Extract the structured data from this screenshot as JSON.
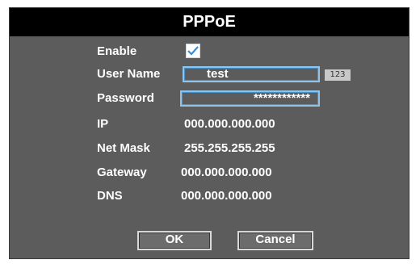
{
  "dialog": {
    "title": "PPPoE"
  },
  "form": {
    "enable_label": "Enable",
    "enable_checked": true,
    "username_label": "User Name",
    "username_value": "test",
    "keyboard_mode": "123",
    "password_label": "Password",
    "password_value": "************",
    "ip_label": "IP",
    "ip_value": "000.000.000.000",
    "netmask_label": "Net Mask",
    "netmask_value": "255.255.255.255",
    "gateway_label": "Gateway",
    "gateway_value": "000.000.000.000",
    "dns_label": "DNS",
    "dns_value": "000.000.000.000"
  },
  "buttons": {
    "ok_label": "OK",
    "cancel_label": "Cancel"
  },
  "colors": {
    "dialog_bg": "#5c5c5c",
    "titlebar_bg": "#000000",
    "field_border": "#8fc3ea",
    "check_color": "#3a8fd6"
  }
}
